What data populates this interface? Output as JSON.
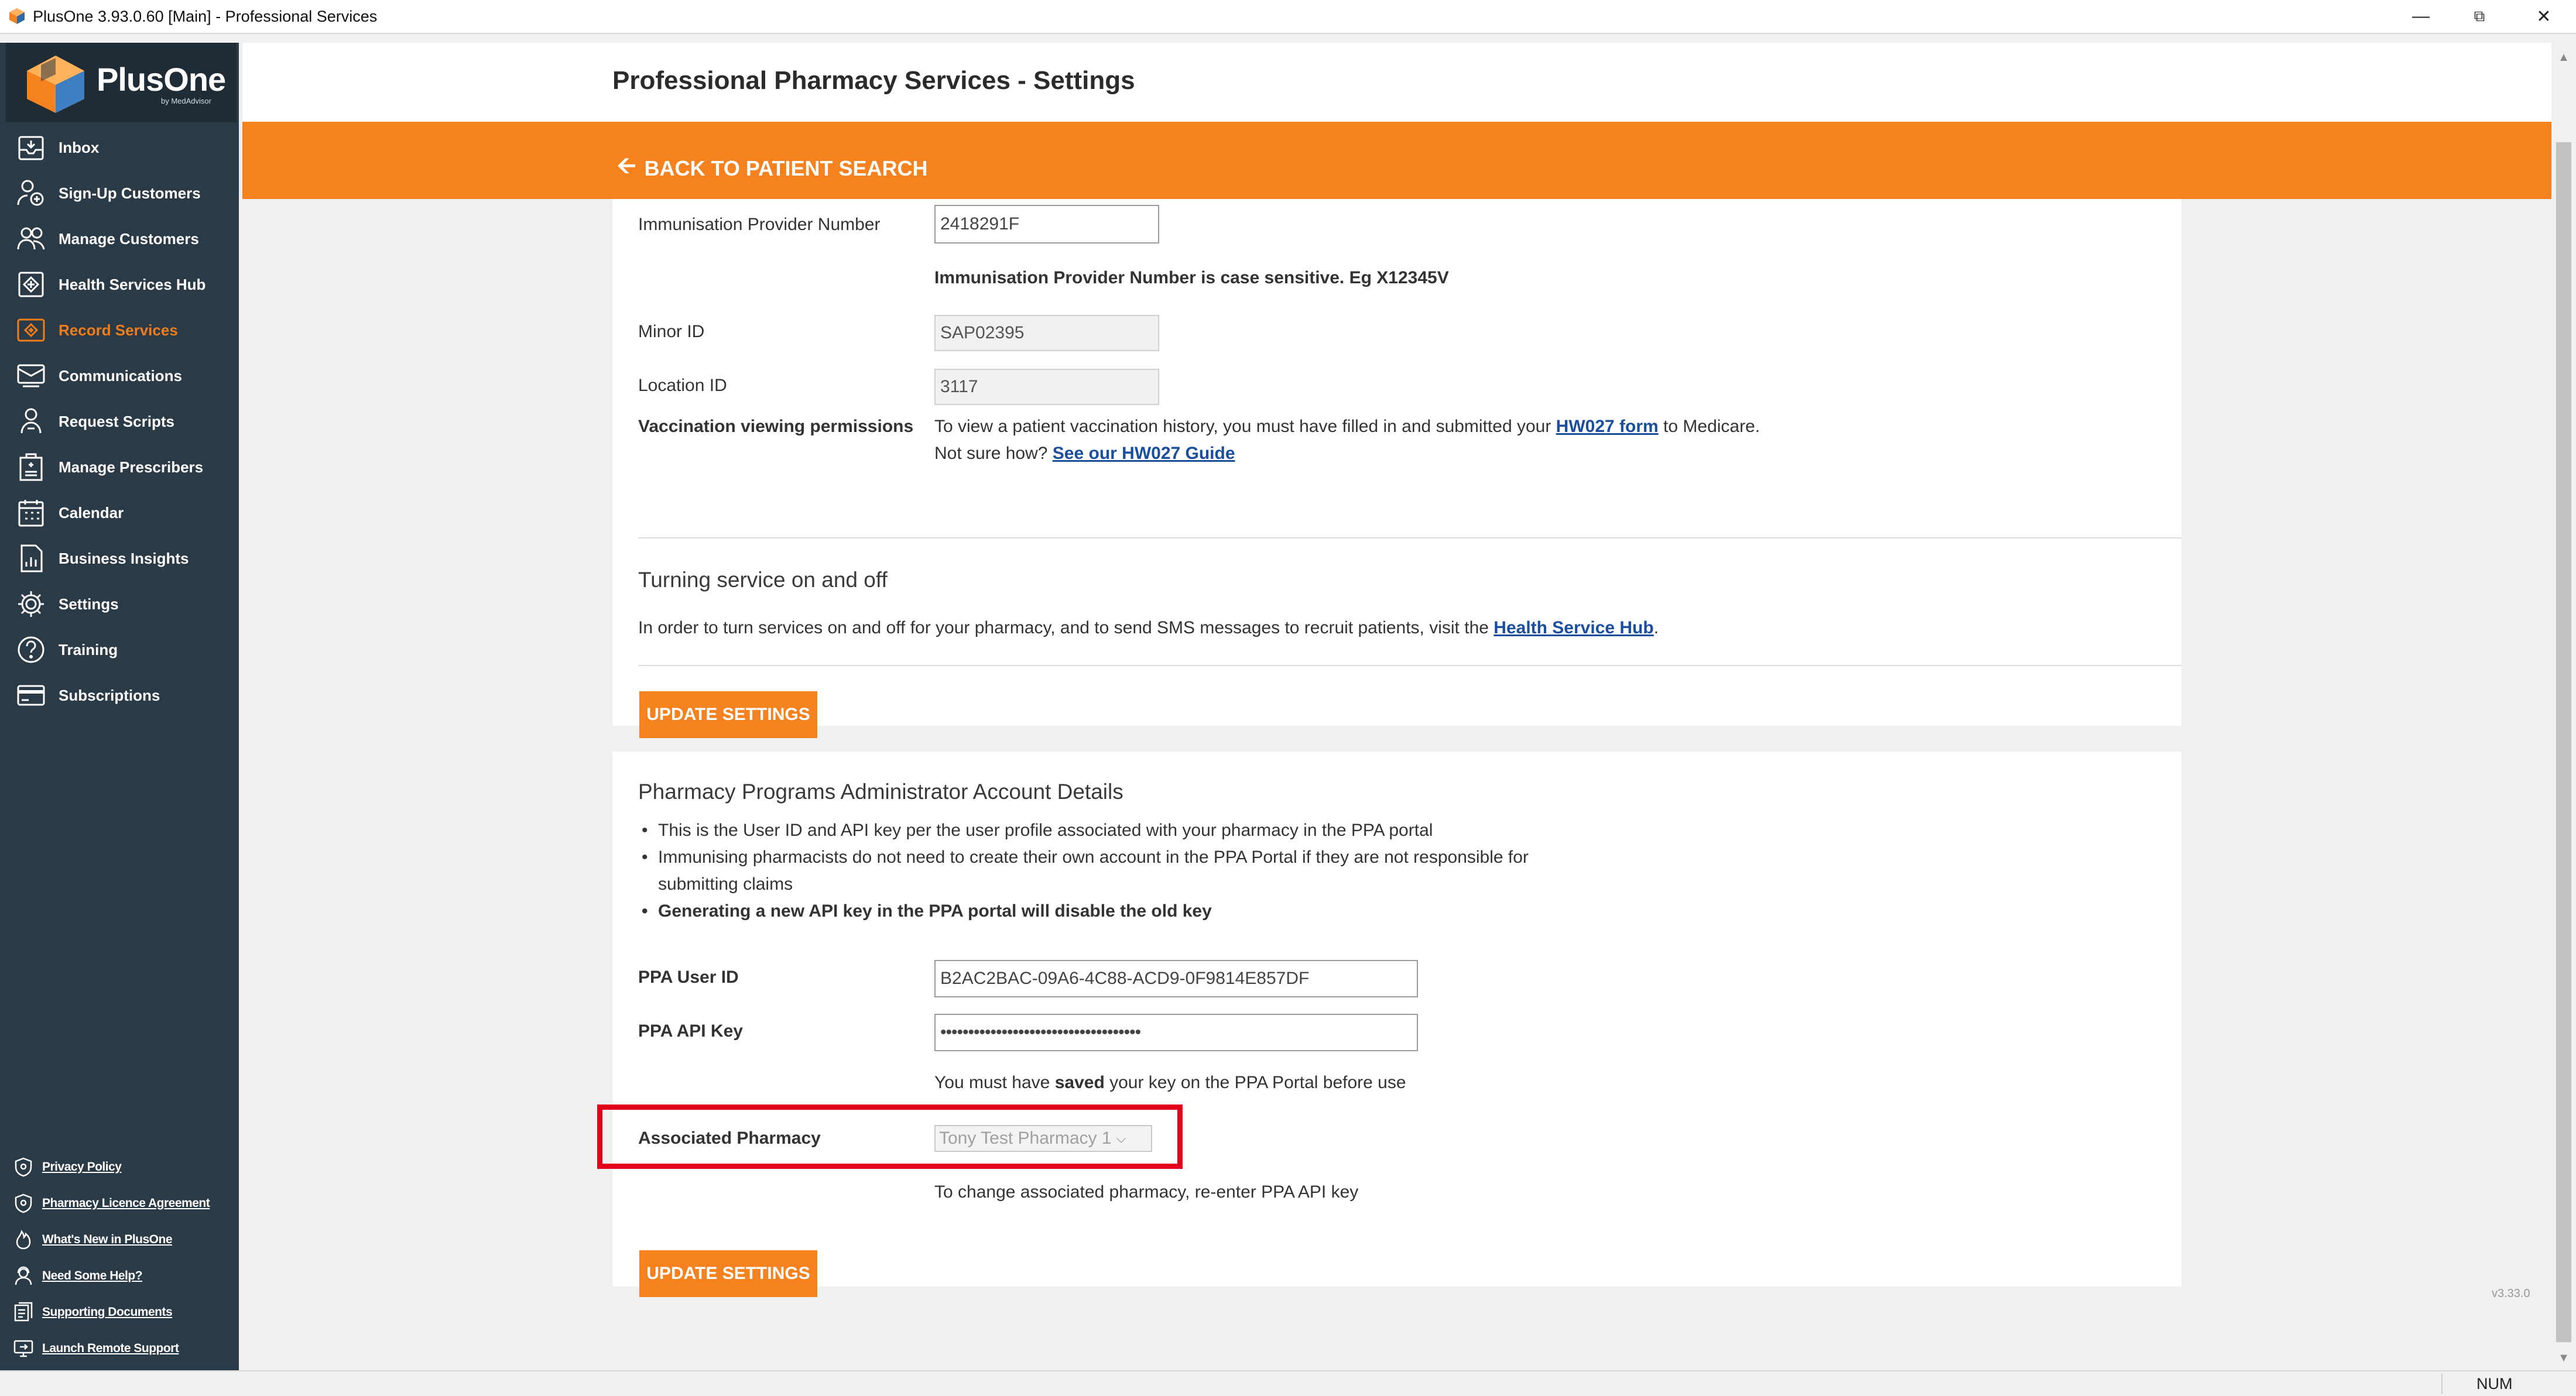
{
  "window": {
    "title": "PlusOne 3.93.0.60 [Main] - Professional Services"
  },
  "brand": {
    "name": "PlusOne",
    "sub": "by MedAdvisor",
    "accent": "#f5821f",
    "sidebar_bg": "#2b3a47"
  },
  "sidebar": {
    "items": [
      {
        "label": "Inbox",
        "icon": "inbox-icon",
        "active": false
      },
      {
        "label": "Sign-Up Customers",
        "icon": "sign-up-icon",
        "active": false
      },
      {
        "label": "Manage Customers",
        "icon": "customers-icon",
        "active": false
      },
      {
        "label": "Health Services Hub",
        "icon": "health-hub-icon",
        "active": false
      },
      {
        "label": "Record Services",
        "icon": "record-services-icon",
        "active": true
      },
      {
        "label": "Communications",
        "icon": "communications-icon",
        "active": false
      },
      {
        "label": "Request Scripts",
        "icon": "request-scripts-icon",
        "active": false
      },
      {
        "label": "Manage Prescribers",
        "icon": "prescribers-icon",
        "active": false
      },
      {
        "label": "Calendar",
        "icon": "calendar-icon",
        "active": false
      },
      {
        "label": "Business Insights",
        "icon": "insights-icon",
        "active": false
      },
      {
        "label": "Settings",
        "icon": "gear-icon",
        "active": false
      },
      {
        "label": "Training",
        "icon": "help-icon",
        "active": false
      },
      {
        "label": "Subscriptions",
        "icon": "card-icon",
        "active": false
      }
    ],
    "footer_links": [
      {
        "label": "Privacy Policy",
        "icon": "shield-icon"
      },
      {
        "label": "Pharmacy Licence Agreement",
        "icon": "shield-icon"
      },
      {
        "label": "What's New in PlusOne",
        "icon": "flame-icon"
      },
      {
        "label": "Need Some Help?",
        "icon": "support-agent-icon"
      },
      {
        "label": "Supporting Documents",
        "icon": "documents-icon"
      },
      {
        "label": "Launch Remote Support",
        "icon": "remote-icon"
      }
    ]
  },
  "page": {
    "title": "Professional Pharmacy Services - Settings",
    "back_label": "BACK TO PATIENT SEARCH"
  },
  "immunisation": {
    "provider_number_label": "Immunisation Provider Number",
    "provider_number_value": "2418291F",
    "provider_number_hint": "Immunisation Provider Number is case sensitive. Eg X12345V",
    "minor_id_label": "Minor ID",
    "minor_id_value": "SAP02395",
    "location_id_label": "Location ID",
    "location_id_value": "3117",
    "vaccination_label": "Vaccination viewing permissions",
    "vaccination_text_1": "To view a patient vaccination history, you must have filled in and submitted your ",
    "vaccination_link_1": "HW027 form",
    "vaccination_text_2": " to Medicare.",
    "vaccination_text_3": "Not sure how? ",
    "vaccination_link_2": "See our HW027 Guide"
  },
  "turning_service": {
    "title": "Turning service on and off",
    "text": "In order to turn services on and off for your pharmacy, and to send SMS messages to recruit patients, visit the ",
    "link": "Health Service Hub",
    "period": ".",
    "button": "UPDATE SETTINGS"
  },
  "ppa": {
    "title": "Pharmacy Programs Administrator Account Details",
    "bullets": [
      "This is the User ID and API key per the user profile associated with your pharmacy in the PPA portal",
      "Immunising pharmacists do not need to create their own account in the PPA Portal if they are not responsible for",
      "submitting claims",
      "Generating a new API key in the PPA portal will disable the old key"
    ],
    "user_id_label": "PPA User ID",
    "user_id_value": "B2AC2BAC-09A6-4C88-ACD9-0F9814E857DF",
    "api_key_label": "PPA API Key",
    "api_key_value": "••••••••••••••••••••••••••••••••••••",
    "saved_note_1": "You must have ",
    "saved_note_bold": "saved",
    "saved_note_2": " your key on the PPA Portal before use",
    "associated_label": "Associated Pharmacy",
    "associated_value": "Tony Test Pharmacy 1",
    "associated_note": "To change associated pharmacy, re-enter PPA API key",
    "button": "UPDATE SETTINGS",
    "highlight_color": "#e3001b"
  },
  "version": "v3.33.0",
  "status": {
    "num": "NUM"
  }
}
